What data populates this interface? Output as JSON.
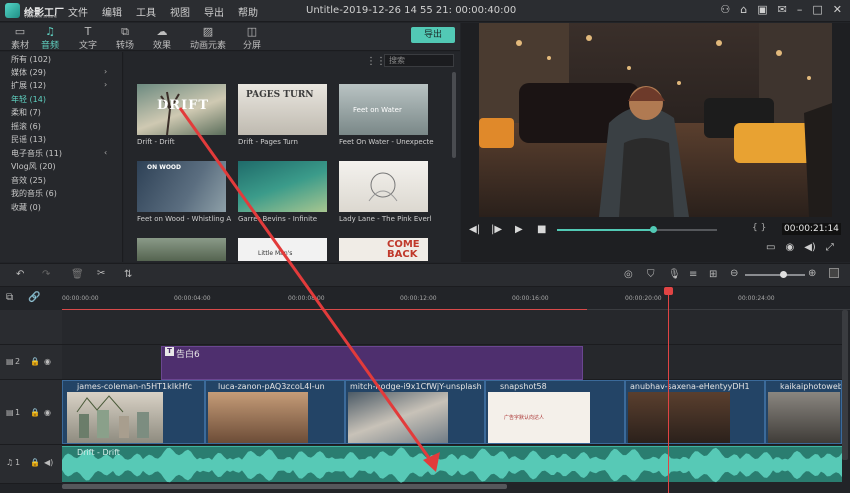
{
  "app": {
    "logo": "绘影工厂",
    "logo_sub": "Wondershare",
    "title": "Untitle-2019-12-26 14 55 21: 00:00:40:00"
  },
  "menu": [
    "文件",
    "编辑",
    "工具",
    "视图",
    "导出",
    "帮助"
  ],
  "tabs": [
    {
      "label": "素材",
      "icon": "folder-icon"
    },
    {
      "label": "音频",
      "icon": "music-note-icon",
      "active": true
    },
    {
      "label": "文字",
      "icon": "text-icon"
    },
    {
      "label": "转场",
      "icon": "transition-icon"
    },
    {
      "label": "效果",
      "icon": "effects-icon"
    },
    {
      "label": "动画元素",
      "icon": "image-icon"
    },
    {
      "label": "分屏",
      "icon": "split-screen-icon"
    }
  ],
  "export_label": "导出",
  "categories": [
    {
      "label": "所有 (102)"
    },
    {
      "label": "媒体 (29)",
      "arrow": true
    },
    {
      "label": "扩展 (12)",
      "arrow": true
    },
    {
      "label": "年轻 (14)",
      "active": true
    },
    {
      "label": "柔和 (7)"
    },
    {
      "label": "摇滚 (6)"
    },
    {
      "label": "民谣 (13)"
    },
    {
      "label": "电子音乐 (11)"
    },
    {
      "label": "Vlog风 (20)"
    },
    {
      "label": "音效 (25)"
    },
    {
      "label": "我的音乐 (6)"
    },
    {
      "label": "收藏 (0)"
    }
  ],
  "search_placeholder": "搜索",
  "library": [
    {
      "caption": "Drift - Drift",
      "thumb_text": "DRIFT"
    },
    {
      "caption": "Drift - Pages Turn",
      "thumb_text": "PAGES TURN"
    },
    {
      "caption": "Feet On Water - Unexpecte",
      "thumb_text": "Feet on Water"
    },
    {
      "caption": "Feet on Wood - Whistling A",
      "thumb_text": "ON WOOD"
    },
    {
      "caption": "Garret Bevins - Infinite",
      "thumb_text": ""
    },
    {
      "caption": "Lady Lane - The Pink Everl",
      "thumb_text": ""
    },
    {
      "caption": "",
      "thumb_text": ""
    },
    {
      "caption": "",
      "thumb_text": "Little Man's"
    },
    {
      "caption": "",
      "thumb_text": "COME BACK"
    }
  ],
  "preview": {
    "timecode": "00:00:21:14",
    "progress": 0.6
  },
  "ruler_ticks": [
    "00:00:00:00",
    "00:00:04:00",
    "00:00:08:00",
    "00:00:12:00",
    "00:00:16:00",
    "00:00:20:00",
    "00:00:24:00"
  ],
  "tracks": {
    "title_track_no": "2",
    "video_track_no": "1",
    "audio_track_no": "1",
    "title_clip": "告白6",
    "video_clips": [
      "james-coleman-n5HT1kIkHfc",
      "luca-zanon-pAQ3zcoL4I-un",
      "mitch-hodge-i9x1CfWjY-unsplash",
      "snapshot58",
      "anubhav-saxena-eHentyyDH1",
      "kaikaiphotoweb"
    ],
    "snapshot_text": "广告字默认向达人",
    "audio_clip": "Drift - Drift"
  }
}
